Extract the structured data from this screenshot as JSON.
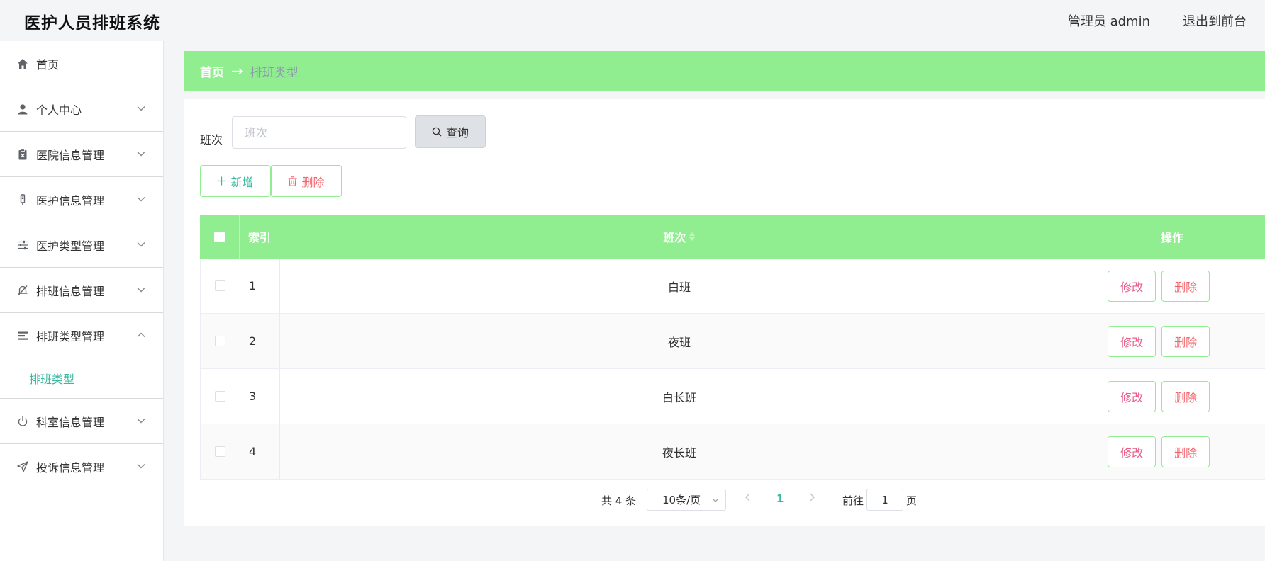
{
  "app": {
    "title": "医护人员排班系统",
    "user": "管理员 admin",
    "logout": "退出到前台"
  },
  "sidebar": {
    "items": [
      {
        "label": "首页",
        "icon": "home-icon"
      },
      {
        "label": "个人中心",
        "icon": "user-icon"
      },
      {
        "label": "医院信息管理",
        "icon": "clipboard-icon"
      },
      {
        "label": "医护信息管理",
        "icon": "thermometer-icon"
      },
      {
        "label": "医护类型管理",
        "icon": "sliders-icon"
      },
      {
        "label": "排班信息管理",
        "icon": "bell-off-icon"
      },
      {
        "label": "排班类型管理",
        "icon": "list-icon",
        "expanded": true,
        "sub": [
          {
            "label": "排班类型"
          }
        ]
      },
      {
        "label": "科室信息管理",
        "icon": "power-icon"
      },
      {
        "label": "投诉信息管理",
        "icon": "send-icon"
      }
    ]
  },
  "breadcrumb": {
    "home": "首页",
    "arrow": "→",
    "current": "排班类型"
  },
  "search": {
    "label": "班次",
    "placeholder": "班次",
    "value": "",
    "button": "查询"
  },
  "actions": {
    "add": "新增",
    "delete": "删除"
  },
  "table": {
    "headers": {
      "index": "索引",
      "name": "班次",
      "ops": "操作"
    },
    "rows": [
      {
        "index": "1",
        "name": "白班"
      },
      {
        "index": "2",
        "name": "夜班"
      },
      {
        "index": "3",
        "name": "白长班"
      },
      {
        "index": "4",
        "name": "夜长班"
      }
    ],
    "row_actions": {
      "edit": "修改",
      "delete": "删除"
    }
  },
  "pagination": {
    "total": "共 4 条",
    "page_size": "10条/页",
    "current_page": "1",
    "goto": "前往",
    "goto_value": "1",
    "page_suffix": "页"
  },
  "colors": {
    "accent": "#90ee90",
    "teal": "#3cb8a0",
    "danger": "#f0636b",
    "pink": "#e8608a"
  }
}
